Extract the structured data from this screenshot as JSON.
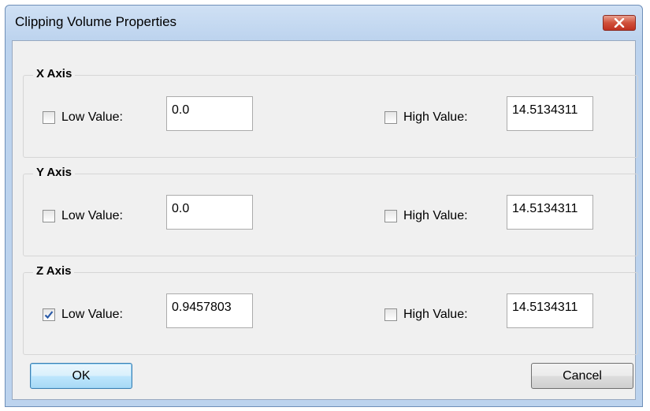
{
  "dialog": {
    "title": "Clipping Volume Properties",
    "close_icon": "close-icon"
  },
  "groups": [
    {
      "label": "X Axis",
      "low": {
        "label": "Low Value:",
        "checked": false,
        "value": "0.0"
      },
      "high": {
        "label": "High Value:",
        "checked": false,
        "value": "14.5134311"
      }
    },
    {
      "label": "Y Axis",
      "low": {
        "label": "Low Value:",
        "checked": false,
        "value": "0.0"
      },
      "high": {
        "label": "High Value:",
        "checked": false,
        "value": "14.5134311"
      }
    },
    {
      "label": "Z Axis",
      "low": {
        "label": "Low Value:",
        "checked": true,
        "value": "0.9457803"
      },
      "high": {
        "label": "High Value:",
        "checked": false,
        "value": "14.5134311"
      }
    }
  ],
  "buttons": {
    "ok": "OK",
    "cancel": "Cancel"
  },
  "colors": {
    "title_gradient": "#bcd3ee",
    "close_button": "#c8402e",
    "checkmark": "#2a5aa8"
  }
}
